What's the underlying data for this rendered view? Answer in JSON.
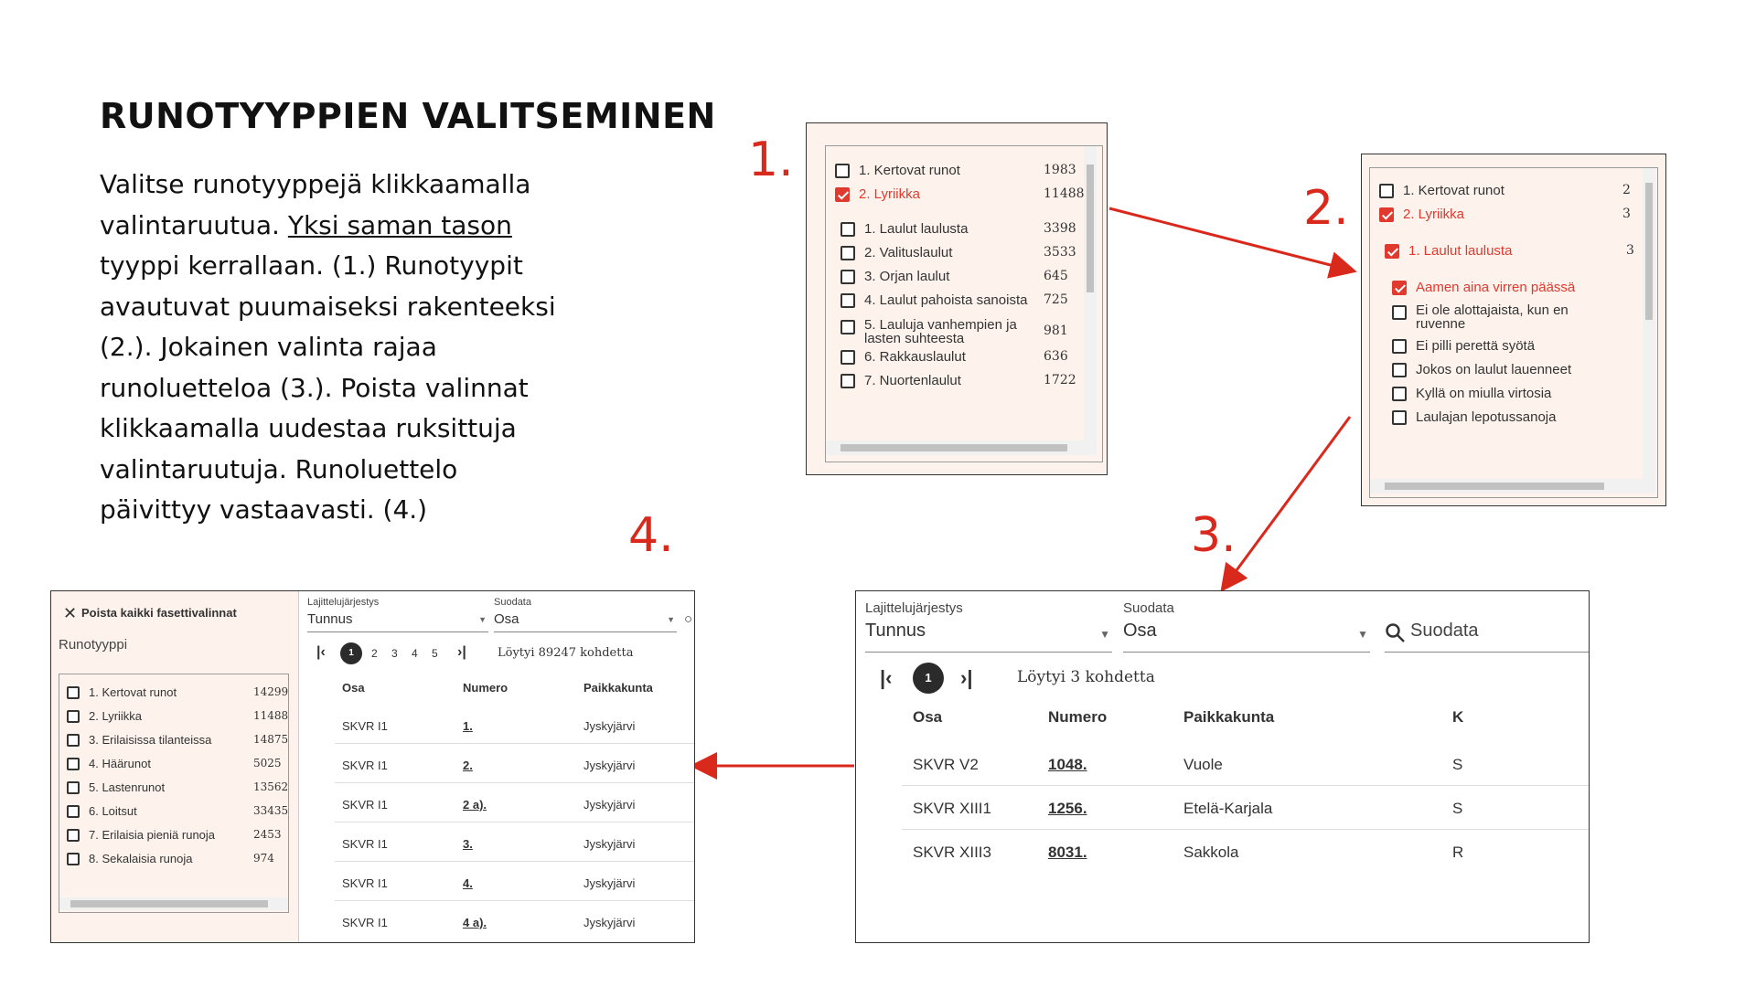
{
  "title": "RUNOTYYPPIEN VALITSEMINEN",
  "instructions": {
    "part1": "Valitse runotyyppejä klikkaamalla valintaruutua. ",
    "underlined": "Yksi saman tason",
    "part2": " tyyppi kerrallaan. (1.) Runotyypit avautuvat puumaiseksi rakenteeksi (2.). Jokainen valinta rajaa runoluetteloa (3.). Poista valinnat klikkaamalla uudestaa ruksittuja valintaruutuja. Runoluettelo päivittyy vastaavasti. (4.)"
  },
  "steps": {
    "s1": "1.",
    "s2": "2.",
    "s3": "3.",
    "s4": "4."
  },
  "colors": {
    "accent": "#d9291c",
    "panel_bg": "#fdf3ec"
  },
  "panel1": {
    "top_items": [
      {
        "label": "1. Kertovat runot",
        "count": "1983",
        "checked": false
      },
      {
        "label": "2. Lyriikka",
        "count": "11488",
        "checked": true
      }
    ],
    "sub_items": [
      {
        "label": "1. Laulut laulusta",
        "count": "3398"
      },
      {
        "label": "2. Valituslaulut",
        "count": "3533"
      },
      {
        "label": "3. Orjan laulut",
        "count": "645"
      },
      {
        "label": "4. Laulut pahoista sanoista",
        "count": "725"
      },
      {
        "label": "5. Lauluja vanhempien ja lasten suhteesta",
        "count": "981"
      },
      {
        "label": "6. Rakkauslaulut",
        "count": "636"
      },
      {
        "label": "7. Nuortenlaulut",
        "count": "1722"
      }
    ]
  },
  "panel2": {
    "top_items": [
      {
        "label": "1. Kertovat runot",
        "count": "2",
        "checked": false
      },
      {
        "label": "2. Lyriikka",
        "count": "3",
        "checked": true
      }
    ],
    "sub_item": {
      "label": "1. Laulut laulusta",
      "count": "3",
      "checked": true
    },
    "leaf_items": [
      {
        "label": "Aamen aina virren päässä",
        "checked": true
      },
      {
        "label": "Ei ole alottajaista, kun en ruvenne",
        "checked": false
      },
      {
        "label": "Ei pilli perettä syötä",
        "checked": false
      },
      {
        "label": "Jokos on laulut lauenneet",
        "checked": false
      },
      {
        "label": "Kyllä on miulla virtosia",
        "checked": false
      },
      {
        "label": "Laulajan lepotussanoja",
        "checked": false
      }
    ]
  },
  "panel3": {
    "sort_label": "Lajittelujärjestys",
    "sort_value": "Tunnus",
    "filter_label": "Suodata",
    "filter_value": "Osa",
    "search_placeholder": "Suodata",
    "current_page": "1",
    "found_text": "Löytyi 3 kohdetta",
    "columns": [
      "Osa",
      "Numero",
      "Paikkakunta",
      "K"
    ],
    "rows": [
      {
        "osa": "SKVR V2",
        "numero": "1048.",
        "paikka": "Vuole",
        "extra": "S"
      },
      {
        "osa": "SKVR XIII1",
        "numero": "1256.",
        "paikka": "Etelä-Karjala",
        "extra": "S"
      },
      {
        "osa": "SKVR XIII3",
        "numero": "8031.",
        "paikka": "Sakkola",
        "extra": "R"
      }
    ]
  },
  "panel4": {
    "clear_label": "Poista kaikki fasettivalinnat",
    "facet_title": "Runotyyppi",
    "facet_items": [
      {
        "label": "1. Kertovat runot",
        "count": "14299"
      },
      {
        "label": "2. Lyriikka",
        "count": "11488"
      },
      {
        "label": "3. Erilaisissa tilanteissa",
        "count": "14875"
      },
      {
        "label": "4. Häärunot",
        "count": "5025"
      },
      {
        "label": "5. Lastenrunot",
        "count": "13562"
      },
      {
        "label": "6. Loitsut",
        "count": "33435"
      },
      {
        "label": "7. Erilaisia pieniä runoja",
        "count": "2453"
      },
      {
        "label": "8. Sekalaisia runoja",
        "count": "974"
      }
    ],
    "sort_label": "Lajittelujärjestys",
    "sort_value": "Tunnus",
    "filter_label": "Suodata",
    "filter_value": "Osa",
    "pages": [
      "1",
      "2",
      "3",
      "4",
      "5"
    ],
    "found_text": "Löytyi 89247 kohdetta",
    "columns": [
      "Osa",
      "Numero",
      "Paikkakunta"
    ],
    "rows": [
      {
        "osa": "SKVR I1",
        "numero": "1.",
        "paikka": "Jyskyjärvi"
      },
      {
        "osa": "SKVR I1",
        "numero": "2.",
        "paikka": "Jyskyjärvi"
      },
      {
        "osa": "SKVR I1",
        "numero": "2 a).",
        "paikka": "Jyskyjärvi"
      },
      {
        "osa": "SKVR I1",
        "numero": "3.",
        "paikka": "Jyskyjärvi"
      },
      {
        "osa": "SKVR I1",
        "numero": "4.",
        "paikka": "Jyskyjärvi"
      },
      {
        "osa": "SKVR I1",
        "numero": "4 a).",
        "paikka": "Jyskyjärvi"
      }
    ]
  }
}
